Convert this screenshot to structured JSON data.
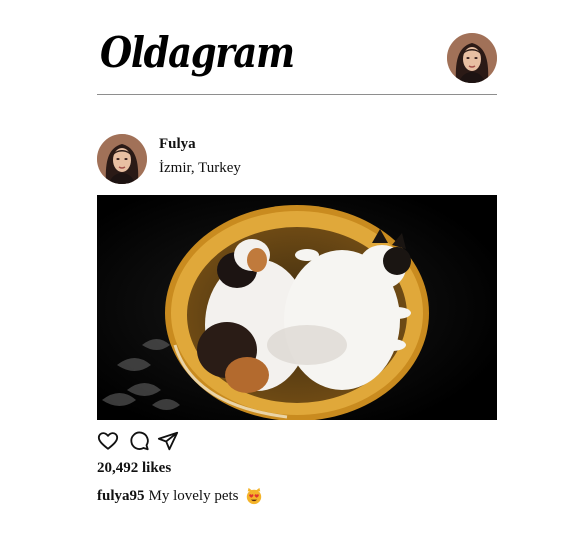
{
  "app": {
    "logo_text": "Oldagram"
  },
  "post": {
    "full_name": "Fulya",
    "location": "İzmir, Turkey",
    "likes": "20,492 likes",
    "username": "fulya95",
    "caption": "My lovely pets",
    "caption_emoji": "smiling-cat-heart-eyes-emoji"
  },
  "icons": {
    "like": "heart-icon",
    "comment": "comment-bubble-icon",
    "share": "paper-plane-icon"
  },
  "colors": {
    "divider": "#8e8e8e",
    "basket": "#d69a2a",
    "emoji": "#f4b42a"
  }
}
